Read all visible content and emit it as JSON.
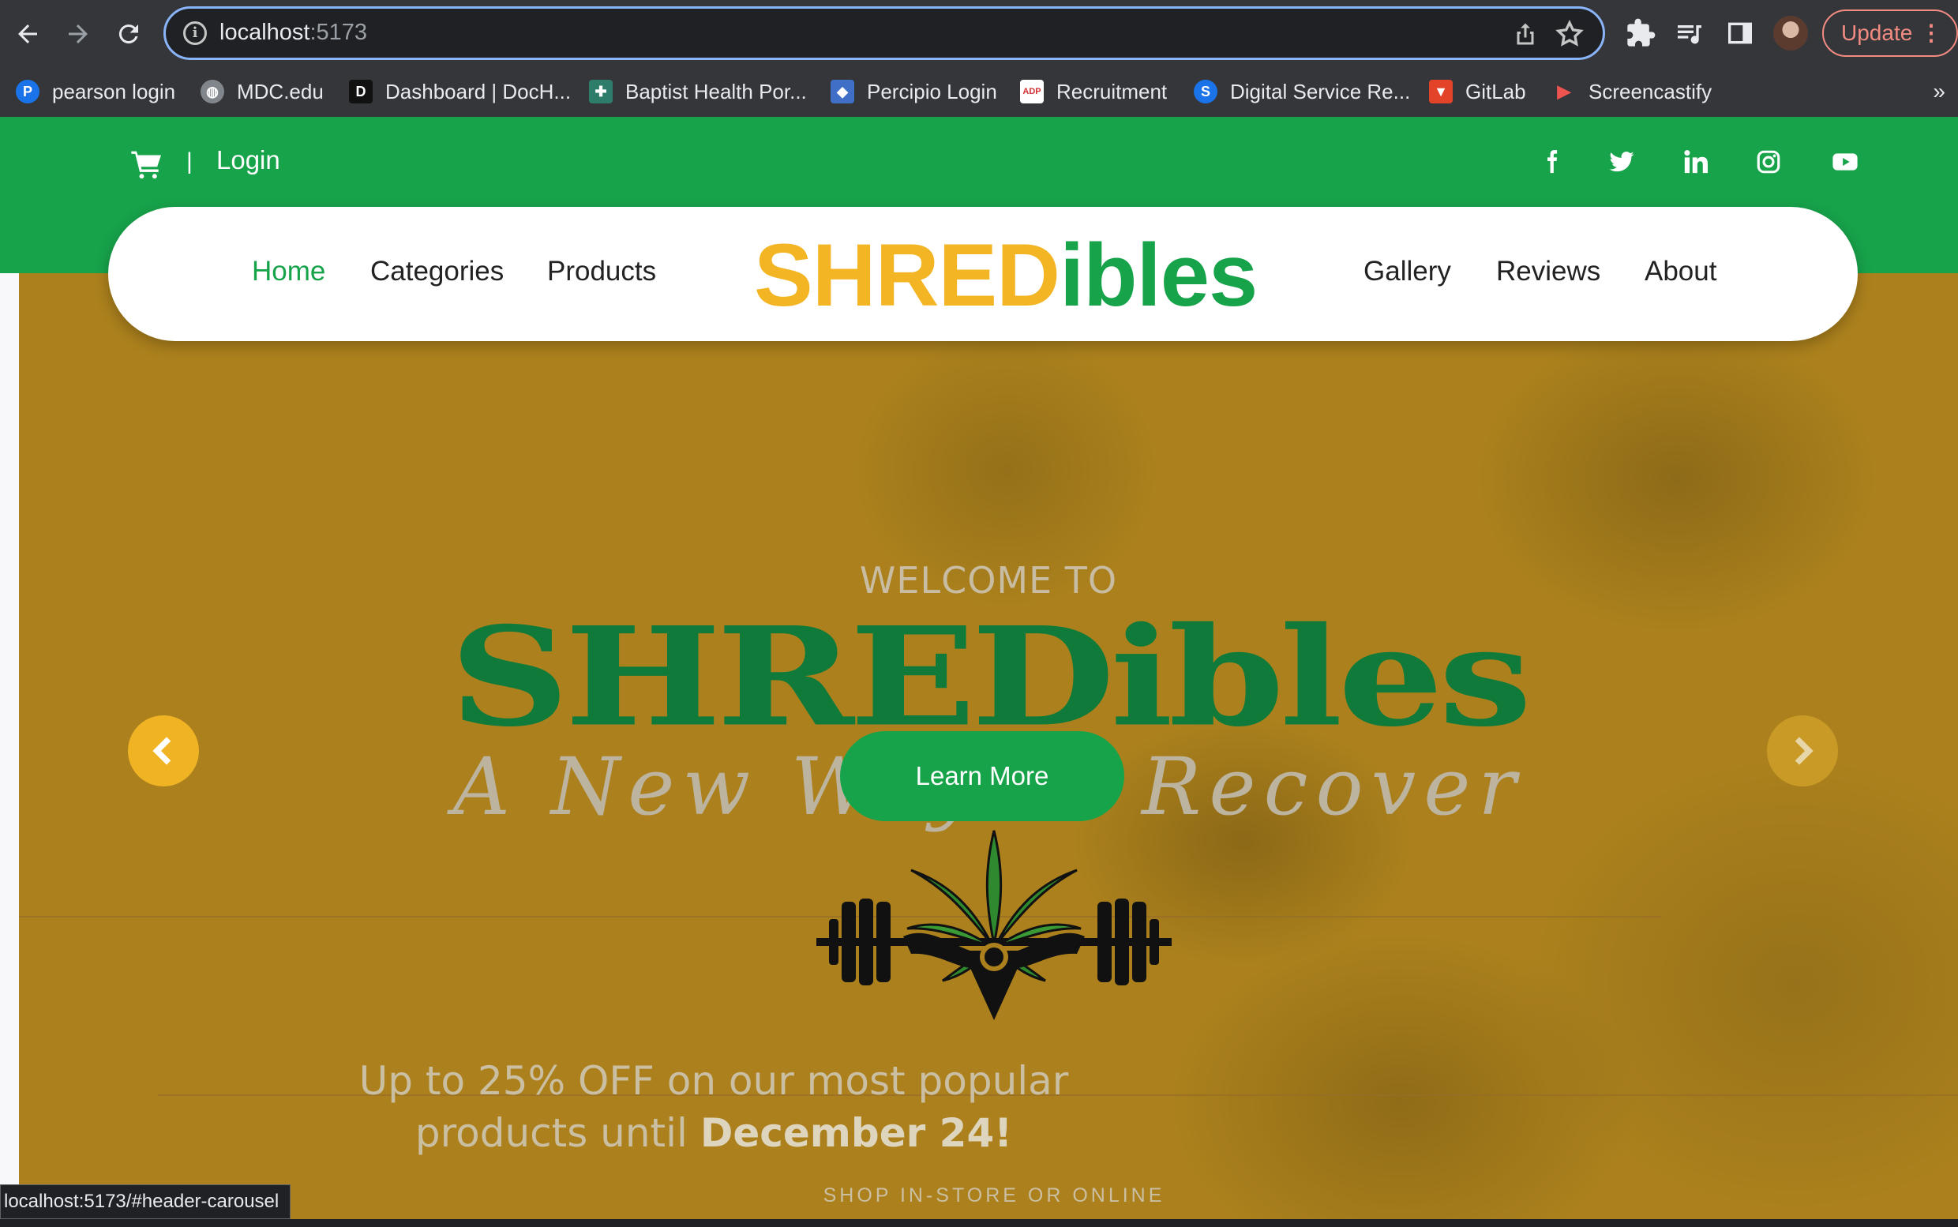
{
  "browser": {
    "url_host": "localhost",
    "url_port": ":5173",
    "update_label": "Update",
    "bookmarks": [
      {
        "label": "pearson login",
        "icon": "pearson-icon",
        "color": "#1a73e8"
      },
      {
        "label": "MDC.edu",
        "icon": "globe-icon",
        "color": "#80868b"
      },
      {
        "label": "Dashboard | DocH...",
        "icon": "doc-icon",
        "color": "#111111"
      },
      {
        "label": "Baptist Health Por...",
        "icon": "baptist-icon",
        "color": "#2e7d6b"
      },
      {
        "label": "Percipio Login",
        "icon": "percipio-icon",
        "color": "#3f6fc6"
      },
      {
        "label": "Recruitment",
        "icon": "adp-icon",
        "color": "#d32f2f"
      },
      {
        "label": "Digital Service Re...",
        "icon": "s-icon",
        "color": "#1a73e8"
      },
      {
        "label": "GitLab",
        "icon": "gitlab-icon",
        "color": "#e24329"
      },
      {
        "label": "Screencastify",
        "icon": "screencastify-icon",
        "color": "#ef5350"
      }
    ],
    "bookmarks_more": "»",
    "status_url": "localhost:5173/#header-carousel"
  },
  "topbar": {
    "separator": "|",
    "login": "Login",
    "social": [
      "facebook-icon",
      "twitter-icon",
      "linkedin-icon",
      "instagram-icon",
      "youtube-icon"
    ]
  },
  "nav": {
    "left": [
      "Home",
      "Categories",
      "Products"
    ],
    "right": [
      "Gallery",
      "Reviews",
      "About"
    ],
    "active": "Home",
    "brand_part1": "SHRED",
    "brand_part2": "ibles"
  },
  "hero": {
    "welcome": "WELCOME TO",
    "title": "SHREDibles",
    "tagline": "A New Way to Recover",
    "cta": "Learn More",
    "promo_line1": "Up to 25% OFF on our most popular",
    "promo_line2_prefix": "products until ",
    "promo_line2_bold": "December 24!",
    "shop_line": "SHOP IN-STORE OR ONLINE"
  },
  "colors": {
    "green": "#17a34a",
    "gold": "#f3b524",
    "hero_bg": "#ac811d",
    "title_green": "#0f7a3a"
  }
}
